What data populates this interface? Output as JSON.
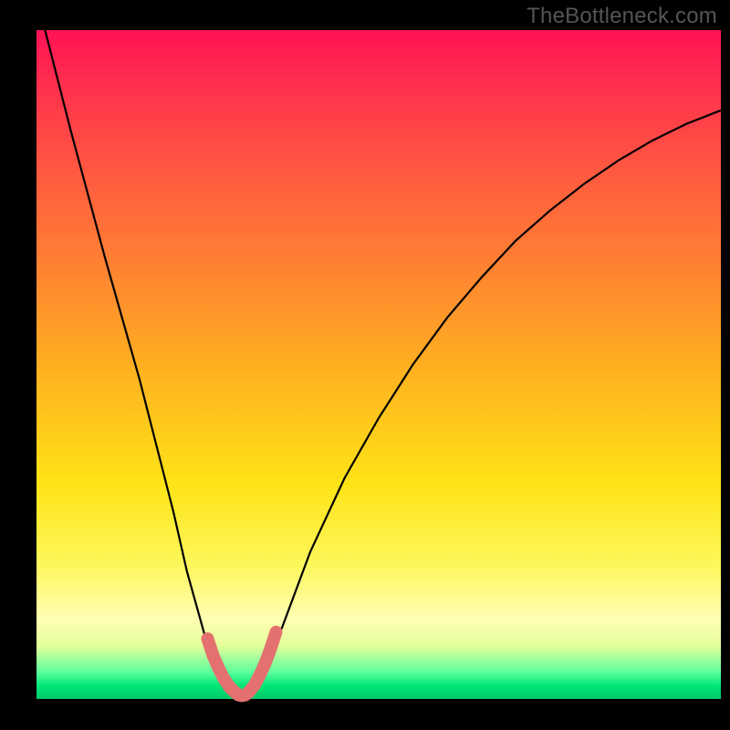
{
  "watermark": "TheBottleneck.com",
  "chart_data": {
    "type": "line",
    "title": "",
    "xlabel": "",
    "ylabel": "",
    "xlim": [
      0,
      100
    ],
    "ylim": [
      0,
      100
    ],
    "series": [
      {
        "name": "bottleneck-curve",
        "x": [
          0,
          5,
          10,
          15,
          20,
          22,
          25,
          26,
          28,
          29,
          30,
          31,
          32,
          34,
          36,
          40,
          45,
          50,
          55,
          60,
          65,
          70,
          75,
          80,
          85,
          90,
          95,
          100
        ],
        "y": [
          105.0,
          85.0,
          66.0,
          48.0,
          28.0,
          19.0,
          8.0,
          5.0,
          2.0,
          1.0,
          0.5,
          1.0,
          2.0,
          6.0,
          11.0,
          22.0,
          33.0,
          42.0,
          50.0,
          57.0,
          63.0,
          68.5,
          73.0,
          77.0,
          80.5,
          83.5,
          86.0,
          88.0
        ]
      },
      {
        "name": "highlight-u",
        "x": [
          25.0,
          25.8,
          26.6,
          27.4,
          28.2,
          29.0,
          29.5,
          30.0,
          30.5,
          31.0,
          31.8,
          32.6,
          33.4,
          34.2,
          35.0
        ],
        "y": [
          9.0,
          6.5,
          4.6,
          3.0,
          1.8,
          1.0,
          0.6,
          0.5,
          0.6,
          1.0,
          2.0,
          3.5,
          5.3,
          7.5,
          10.0
        ]
      }
    ],
    "highlight_color": "#e4716f",
    "line_color": "#000000"
  },
  "colors": {
    "page_bg": "#000000",
    "gradient_top": "#ff1255",
    "gradient_mid": "#fff25a",
    "gradient_bot": "#00c86a",
    "curve": "#000000",
    "highlight": "#e4716f",
    "watermark": "#555555"
  }
}
